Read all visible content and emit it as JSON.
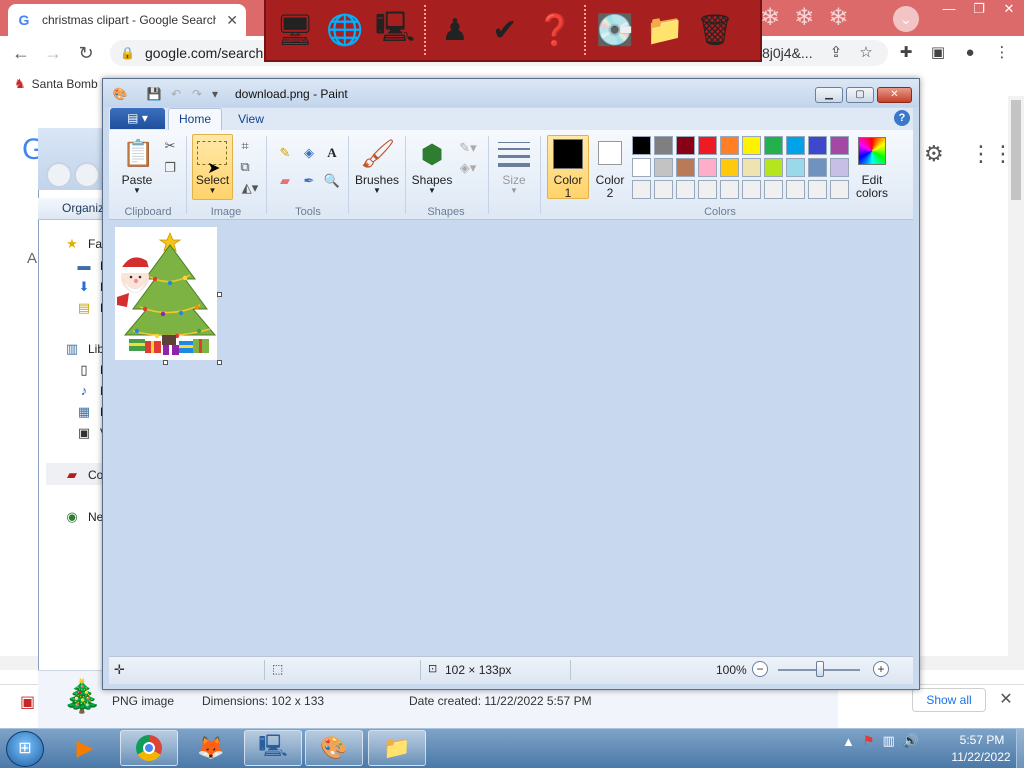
{
  "chrome": {
    "tab_title": "christmas clipart - Google Search",
    "url": "google.com/search?",
    "url_tail": "8j0j4&...",
    "bookmark": "Santa Bomb",
    "colors": {
      "tabbar": "#dc6a6a",
      "omnibox": "#f1f3f4"
    },
    "download_show_all": "Show all"
  },
  "explorer": {
    "organize": "Organiz",
    "favorites": "Fav",
    "fav_items": [
      "D",
      "D",
      "R"
    ],
    "libraries": "Lib",
    "lib_items": [
      "D",
      "M",
      "P",
      "V"
    ],
    "computer": "Co",
    "network": "Net",
    "details": {
      "type": "PNG image",
      "dimensions": "Dimensions: 102 x 133",
      "date_created": "Date created: 11/22/2022 5:57 PM"
    }
  },
  "paint": {
    "title": "download.png - Paint",
    "tabs": {
      "home": "Home",
      "view": "View"
    },
    "groups": {
      "clipboard": "Clipboard",
      "image": "Image",
      "tools": "Tools",
      "shapes": "Shapes",
      "colors": "Colors"
    },
    "buttons": {
      "paste": "Paste",
      "select": "Select",
      "brushes": "Brushes",
      "shapes": "Shapes",
      "size": "Size",
      "color1": "Color",
      "color1_num": "1",
      "color2": "Color",
      "color2_num": "2",
      "edit_colors_1": "Edit",
      "edit_colors_2": "colors"
    },
    "palette_row1": [
      "#000000",
      "#7f7f7f",
      "#880015",
      "#ed1c24",
      "#ff7f27",
      "#fff200",
      "#22b14c",
      "#00a2e8",
      "#3f48cc",
      "#a349a4"
    ],
    "palette_row2": [
      "#ffffff",
      "#c3c3c3",
      "#b97a57",
      "#ffaec9",
      "#ffc90e",
      "#efe4b0",
      "#b5e61d",
      "#99d9ea",
      "#7092be",
      "#c8bfe7"
    ],
    "palette_row3": [
      "#f0f0f0",
      "#f0f0f0",
      "#f0f0f0",
      "#f0f0f0",
      "#f0f0f0",
      "#f0f0f0",
      "#f0f0f0",
      "#f0f0f0",
      "#f0f0f0",
      "#f0f0f0"
    ],
    "status": {
      "image_size": "102 × 133px",
      "zoom": "100%"
    }
  },
  "taskbar": {
    "time": "5:57 PM",
    "date": "11/22/2022"
  }
}
